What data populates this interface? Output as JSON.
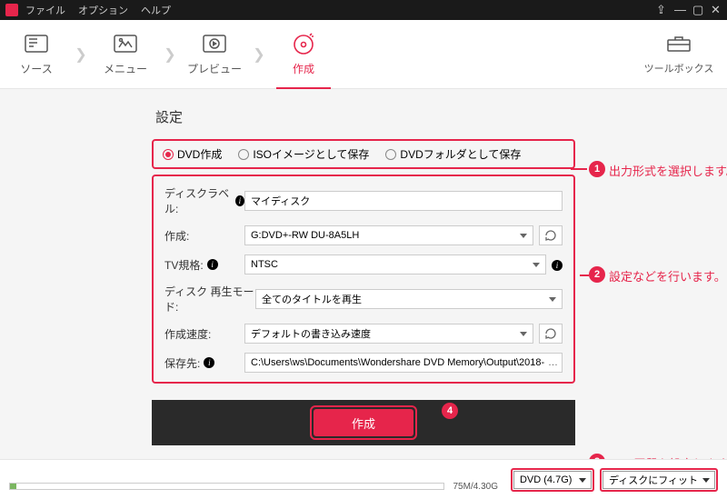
{
  "menu": {
    "file": "ファイル",
    "option": "オプション",
    "help": "ヘルプ"
  },
  "tabs": {
    "source": "ソース",
    "menu": "メニュー",
    "preview": "プレビュー",
    "create": "作成",
    "toolbox": "ツールボックス"
  },
  "settings": {
    "title": "設定",
    "format": {
      "dvd": "DVD作成",
      "iso": "ISOイメージとして保存",
      "folder": "DVDフォルダとして保存"
    },
    "labels": {
      "disclabel": "ディスクラベル:",
      "create": "作成:",
      "tvstd": "TV規格:",
      "playmode": "ディスク 再生モード:",
      "speed": "作成速度:",
      "saveto": "保存先:"
    },
    "values": {
      "disclabel": "マイディスク",
      "drive": "G:DVD+-RW DU-8A5LH",
      "tvstd": "NTSC",
      "playmode": "全てのタイトルを再生",
      "speed": "デフォルトの書き込み速度",
      "saveto": "C:\\Users\\ws\\Documents\\Wondershare DVD Memory\\Output\\2018-"
    },
    "burn": "作成"
  },
  "callouts": {
    "c1": "出力形式を選択します。",
    "c2": "設定などを行います。",
    "c3": "DVD画質を設定します。"
  },
  "footer": {
    "size": "75M/4.30G",
    "disc": "DVD (4.7G)",
    "fit": "ディスクにフィット"
  }
}
